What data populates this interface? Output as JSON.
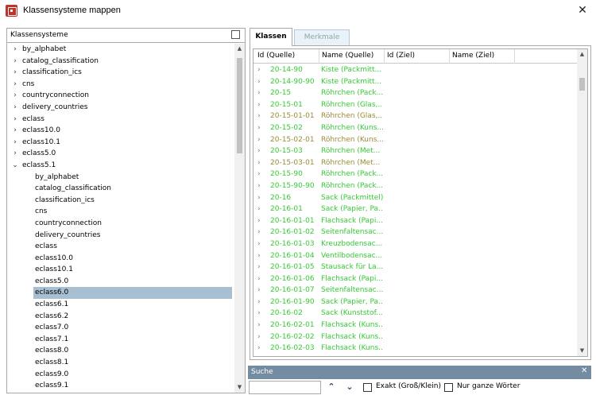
{
  "window": {
    "title": "Klassensysteme mappen",
    "close_glyph": "✕"
  },
  "tree": {
    "header": "Klassensysteme",
    "items": [
      {
        "label": "by_alphabet",
        "level": 0,
        "chevron": "›"
      },
      {
        "label": "catalog_classification",
        "level": 0,
        "chevron": "›"
      },
      {
        "label": "classification_ics",
        "level": 0,
        "chevron": "›"
      },
      {
        "label": "cns",
        "level": 0,
        "chevron": "›"
      },
      {
        "label": "countryconnection",
        "level": 0,
        "chevron": "›"
      },
      {
        "label": "delivery_countries",
        "level": 0,
        "chevron": "›"
      },
      {
        "label": "eclass",
        "level": 0,
        "chevron": "›"
      },
      {
        "label": "eclass10.0",
        "level": 0,
        "chevron": "›"
      },
      {
        "label": "eclass10.1",
        "level": 0,
        "chevron": "›"
      },
      {
        "label": "eclass5.0",
        "level": 0,
        "chevron": "›"
      },
      {
        "label": "eclass5.1",
        "level": 0,
        "chevron": "⌄"
      },
      {
        "label": "by_alphabet",
        "level": 1
      },
      {
        "label": "catalog_classification",
        "level": 1
      },
      {
        "label": "classification_ics",
        "level": 1
      },
      {
        "label": "cns",
        "level": 1
      },
      {
        "label": "countryconnection",
        "level": 1
      },
      {
        "label": "delivery_countries",
        "level": 1
      },
      {
        "label": "eclass",
        "level": 1
      },
      {
        "label": "eclass10.0",
        "level": 1
      },
      {
        "label": "eclass10.1",
        "level": 1
      },
      {
        "label": "eclass5.0",
        "level": 1
      },
      {
        "label": "eclass6.0",
        "level": 1,
        "selected": true
      },
      {
        "label": "eclass6.1",
        "level": 1
      },
      {
        "label": "eclass6.2",
        "level": 1
      },
      {
        "label": "eclass7.0",
        "level": 1
      },
      {
        "label": "eclass7.1",
        "level": 1
      },
      {
        "label": "eclass8.0",
        "level": 1
      },
      {
        "label": "eclass8.1",
        "level": 1
      },
      {
        "label": "eclass9.0",
        "level": 1
      },
      {
        "label": "eclass9.1",
        "level": 1
      }
    ]
  },
  "tabs": [
    {
      "label": "Klassen",
      "active": true
    },
    {
      "label": "Merkmale",
      "active": false
    }
  ],
  "grid": {
    "columns": [
      "Id (Quelle)",
      "Name (Quelle)",
      "Id (Ziel)",
      "Name (Ziel)"
    ],
    "colors": {
      "green": "#34c934",
      "olive": "#9c8a35"
    },
    "rows": [
      {
        "id": "20-14-90",
        "name": "Kiste (Packmitt...",
        "color": "green"
      },
      {
        "id": "20-14-90-90",
        "name": "Kiste (Packmitt...",
        "color": "green"
      },
      {
        "id": "20-15",
        "name": "Röhrchen (Pack...",
        "color": "green"
      },
      {
        "id": "20-15-01",
        "name": "Röhrchen (Glas,...",
        "color": "green"
      },
      {
        "id": "20-15-01-01",
        "name": "Röhrchen (Glas,...",
        "color": "olive"
      },
      {
        "id": "20-15-02",
        "name": "Röhrchen (Kuns...",
        "color": "green"
      },
      {
        "id": "20-15-02-01",
        "name": "Röhrchen (Kuns...",
        "color": "olive"
      },
      {
        "id": "20-15-03",
        "name": "Röhrchen (Met...",
        "color": "green"
      },
      {
        "id": "20-15-03-01",
        "name": "Röhrchen (Met...",
        "color": "olive"
      },
      {
        "id": "20-15-90",
        "name": "Röhrchen (Pack...",
        "color": "green"
      },
      {
        "id": "20-15-90-90",
        "name": "Röhrchen (Pack...",
        "color": "green"
      },
      {
        "id": "20-16",
        "name": "Sack (Packmittel)",
        "color": "green"
      },
      {
        "id": "20-16-01",
        "name": "Sack (Papier, Pa...",
        "color": "green"
      },
      {
        "id": "20-16-01-01",
        "name": "Flachsack (Papi...",
        "color": "green"
      },
      {
        "id": "20-16-01-02",
        "name": "Seitenfaltensac...",
        "color": "green"
      },
      {
        "id": "20-16-01-03",
        "name": "Kreuzbodensac...",
        "color": "green"
      },
      {
        "id": "20-16-01-04",
        "name": "Ventilbodensac...",
        "color": "green"
      },
      {
        "id": "20-16-01-05",
        "name": "Stausack für La...",
        "color": "green"
      },
      {
        "id": "20-16-01-06",
        "name": "Flachsack (Papi...",
        "color": "green"
      },
      {
        "id": "20-16-01-07",
        "name": "Seitenfaltensac...",
        "color": "green"
      },
      {
        "id": "20-16-01-90",
        "name": "Sack (Papier, Pa...",
        "color": "green"
      },
      {
        "id": "20-16-02",
        "name": "Sack (Kunststof...",
        "color": "green"
      },
      {
        "id": "20-16-02-01",
        "name": "Flachsack (Kuns...",
        "color": "green"
      },
      {
        "id": "20-16-02-02",
        "name": "Flachsack (Kuns...",
        "color": "green"
      },
      {
        "id": "20-16-02-03",
        "name": "Flachsack (Kuns...",
        "color": "green"
      }
    ]
  },
  "search": {
    "title": "Suche",
    "close_glyph": "✕",
    "value": "",
    "up_glyph": "⌃",
    "down_glyph": "⌄",
    "exact_label": "Exakt (Groß/Klein)",
    "whole_words_label": "Nur ganze Wörter"
  }
}
